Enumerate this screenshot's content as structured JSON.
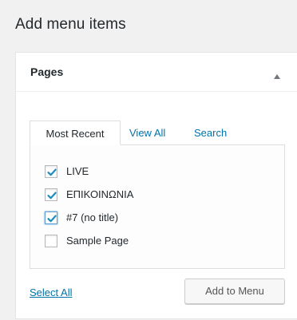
{
  "heading": "Add menu items",
  "panel": {
    "title": "Pages",
    "toggle_icon": "triangle-up-icon",
    "expanded": true
  },
  "tabs": [
    {
      "label": "Most Recent",
      "active": true
    },
    {
      "label": "View All",
      "active": false
    },
    {
      "label": "Search",
      "active": false
    }
  ],
  "items": [
    {
      "label": "LIVE",
      "checked": true
    },
    {
      "label": "ΕΠΙΚΟΙΝΩΝΙΑ",
      "checked": true
    },
    {
      "label": "#7 (no title)",
      "checked": true
    },
    {
      "label": "Sample Page",
      "checked": false
    }
  ],
  "footer": {
    "select_all": "Select All",
    "add_button": "Add to Menu"
  },
  "colors": {
    "background": "#f1f1f1",
    "link": "#0073aa",
    "checkmark": "#1e8cbe",
    "text": "#23282d"
  }
}
